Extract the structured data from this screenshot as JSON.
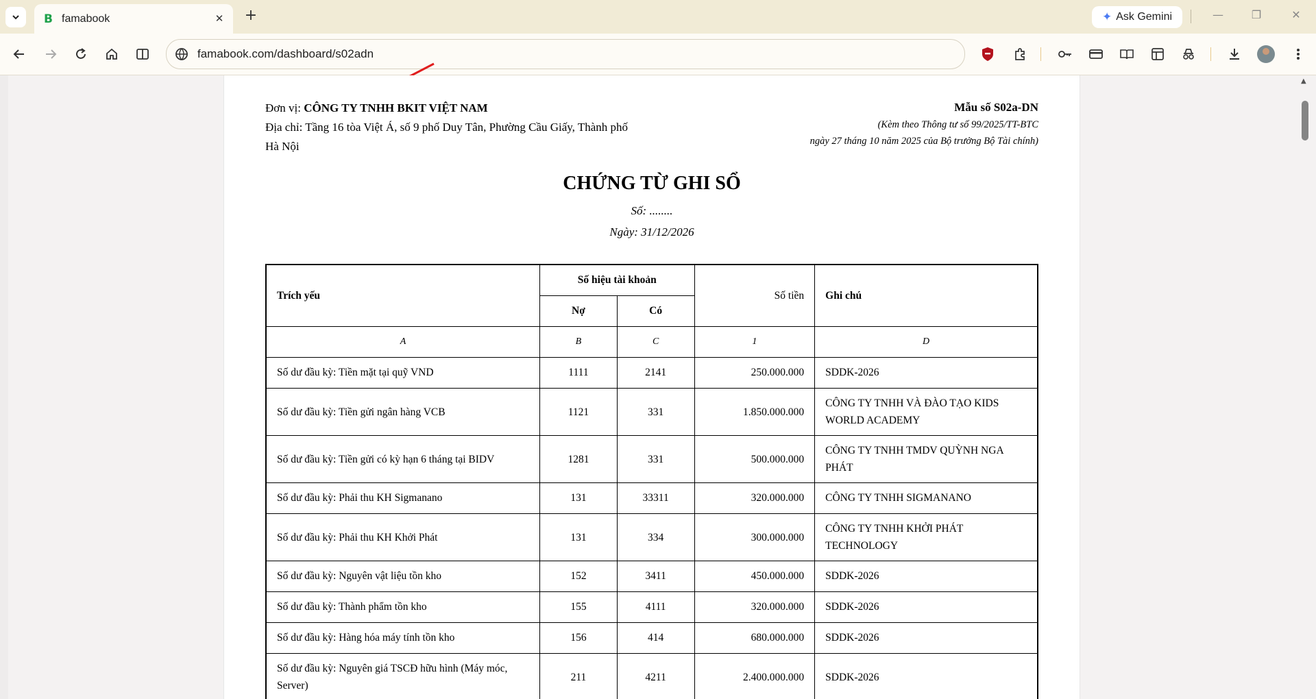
{
  "browser": {
    "tab_title": "famabook",
    "tab_favicon": "B",
    "url": "famabook.com/dashboard/s02adn",
    "ask_gemini": "Ask Gemini",
    "accent_color": "#1ea14a"
  },
  "document": {
    "unit_label": "Đơn vị:",
    "unit_name": "CÔNG TY TNHH BKIT VIỆT NAM",
    "address_line1": "Địa chỉ: Tầng 16 tòa Việt Á, số 9 phố Duy Tân, Phường Cầu Giấy, Thành phố",
    "address_line2": "Hà Nội",
    "form_no": "Mẫu số S02a-DN",
    "form_note1": "(Kèm theo Thông tư số 99/2025/TT-BTC",
    "form_note2": "ngày 27 tháng 10 năm 2025 của Bộ trưởng Bộ Tài chính)",
    "title": "CHỨNG TỪ GHI SỔ",
    "number": "Số: ........",
    "date": "Ngày: 31/12/2026"
  },
  "table": {
    "headers": {
      "summary": "Trích yếu",
      "account_group": "Số hiệu tài khoản",
      "debit": "Nợ",
      "credit": "Có",
      "amount": "Số tiền",
      "note": "Ghi chú"
    },
    "codes": [
      "A",
      "B",
      "C",
      "1",
      "D"
    ],
    "rows": [
      {
        "summary": "Số dư đầu kỳ: Tiền mặt tại quỹ VND",
        "debit": "1111",
        "credit": "2141",
        "amount": "250.000.000",
        "note": "SDDK-2026"
      },
      {
        "summary": "Số dư đầu kỳ: Tiền gửi ngân hàng VCB",
        "debit": "1121",
        "credit": "331",
        "amount": "1.850.000.000",
        "note": "CÔNG TY TNHH VÀ ĐÀO TẠO KIDS WORLD ACADEMY"
      },
      {
        "summary": "Số dư đầu kỳ: Tiền gửi có kỳ hạn 6 tháng tại BIDV",
        "debit": "1281",
        "credit": "331",
        "amount": "500.000.000",
        "note": "CÔNG TY TNHH TMDV QUỲNH NGA PHÁT"
      },
      {
        "summary": "Số dư đầu kỳ: Phải thu KH Sigmanano",
        "debit": "131",
        "credit": "33311",
        "amount": "320.000.000",
        "note": "CÔNG TY TNHH SIGMANANO"
      },
      {
        "summary": "Số dư đầu kỳ: Phải thu KH Khởi Phát",
        "debit": "131",
        "credit": "334",
        "amount": "300.000.000",
        "note": "CÔNG TY TNHH KHỞI PHÁT TECHNOLOGY"
      },
      {
        "summary": "Số dư đầu kỳ: Nguyên vật liệu tồn kho",
        "debit": "152",
        "credit": "3411",
        "amount": "450.000.000",
        "note": "SDDK-2026"
      },
      {
        "summary": "Số dư đầu kỳ: Thành phẩm tồn kho",
        "debit": "155",
        "credit": "4111",
        "amount": "320.000.000",
        "note": "SDDK-2026"
      },
      {
        "summary": "Số dư đầu kỳ: Hàng hóa máy tính tồn kho",
        "debit": "156",
        "credit": "414",
        "amount": "680.000.000",
        "note": "SDDK-2026"
      },
      {
        "summary": "Số dư đầu kỳ: Nguyên giá TSCĐ hữu hình (Máy móc, Server)",
        "debit": "211",
        "credit": "4211",
        "amount": "2.400.000.000",
        "note": "SDDK-2026"
      }
    ]
  }
}
